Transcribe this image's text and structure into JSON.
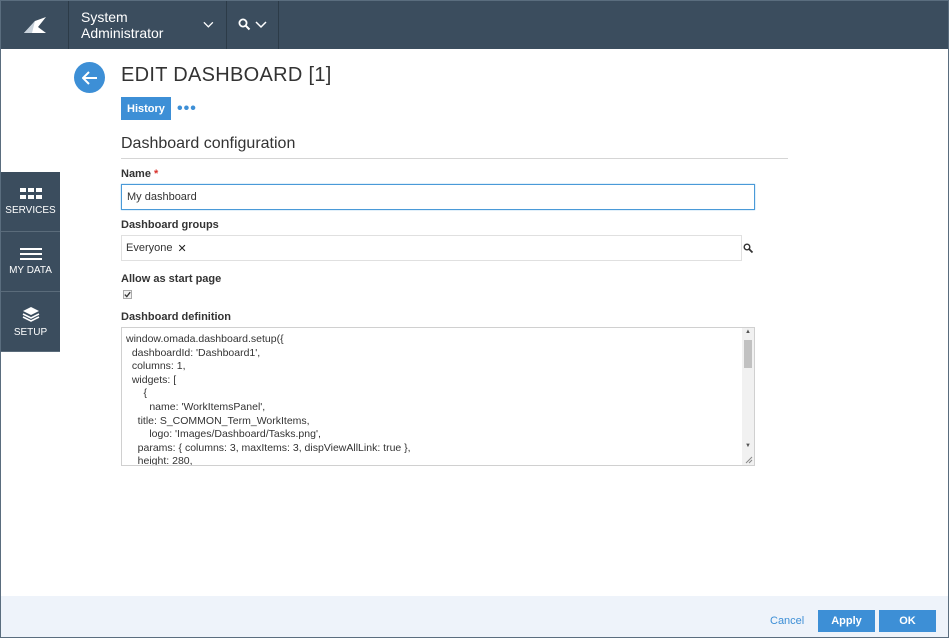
{
  "header": {
    "user_label": "System Administrator"
  },
  "sidenav": {
    "items": [
      {
        "label": "SERVICES",
        "icon": "grid-icon"
      },
      {
        "label": "MY DATA",
        "icon": "list-icon"
      },
      {
        "label": "SETUP",
        "icon": "layers-icon"
      }
    ]
  },
  "page": {
    "title": "EDIT DASHBOARD [1]",
    "history_tab": "History",
    "more": "•••",
    "section_title": "Dashboard configuration"
  },
  "form": {
    "name_label": "Name",
    "name_required": "*",
    "name_value": "My dashboard",
    "groups_label": "Dashboard groups",
    "groups_chip": "Everyone",
    "groups_chip_remove": "✕",
    "start_page_label": "Allow as start page",
    "start_page_checked": true,
    "definition_label": "Dashboard definition",
    "definition_value": "window.omada.dashboard.setup({\n  dashboardId: 'Dashboard1',\n  columns: 1,\n  widgets: [\n      {\n        name: 'WorkItemsPanel',\n    title: S_COMMON_Term_WorkItems,\n        logo: 'Images/Dashboard/Tasks.png',\n    params: { columns: 3, maxItems: 3, dispViewAllLink: true },\n    height: 280,"
  },
  "footer": {
    "cancel": "Cancel",
    "apply": "Apply",
    "ok": "OK"
  },
  "colors": {
    "topbar": "#3b4d5e",
    "accent": "#3d8fd6",
    "footer_bg": "#eef3fa",
    "required": "#d9312b"
  }
}
